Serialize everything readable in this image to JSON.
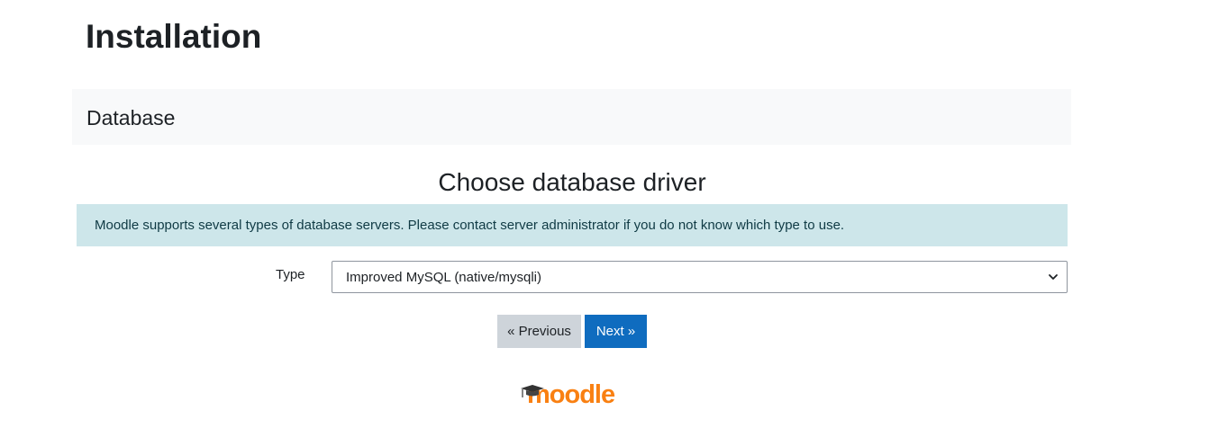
{
  "page": {
    "title": "Installation"
  },
  "section": {
    "title": "Database"
  },
  "main": {
    "heading": "Choose database driver",
    "info_text": "Moodle supports several types of database servers. Please contact server administrator if you do not know which type to use.",
    "type_field": {
      "label": "Type",
      "selected_value": "Improved MySQL (native/mysqli)"
    },
    "buttons": {
      "previous_label": "« Previous",
      "next_label": "Next »"
    }
  },
  "footer": {
    "logo_text": "moodle",
    "logo_icon": "graduation-cap-icon"
  },
  "colors": {
    "primary": "#0f6cbf",
    "secondary": "#ced4da",
    "alert_bg": "#cde6ea",
    "brand": "#f98012"
  }
}
